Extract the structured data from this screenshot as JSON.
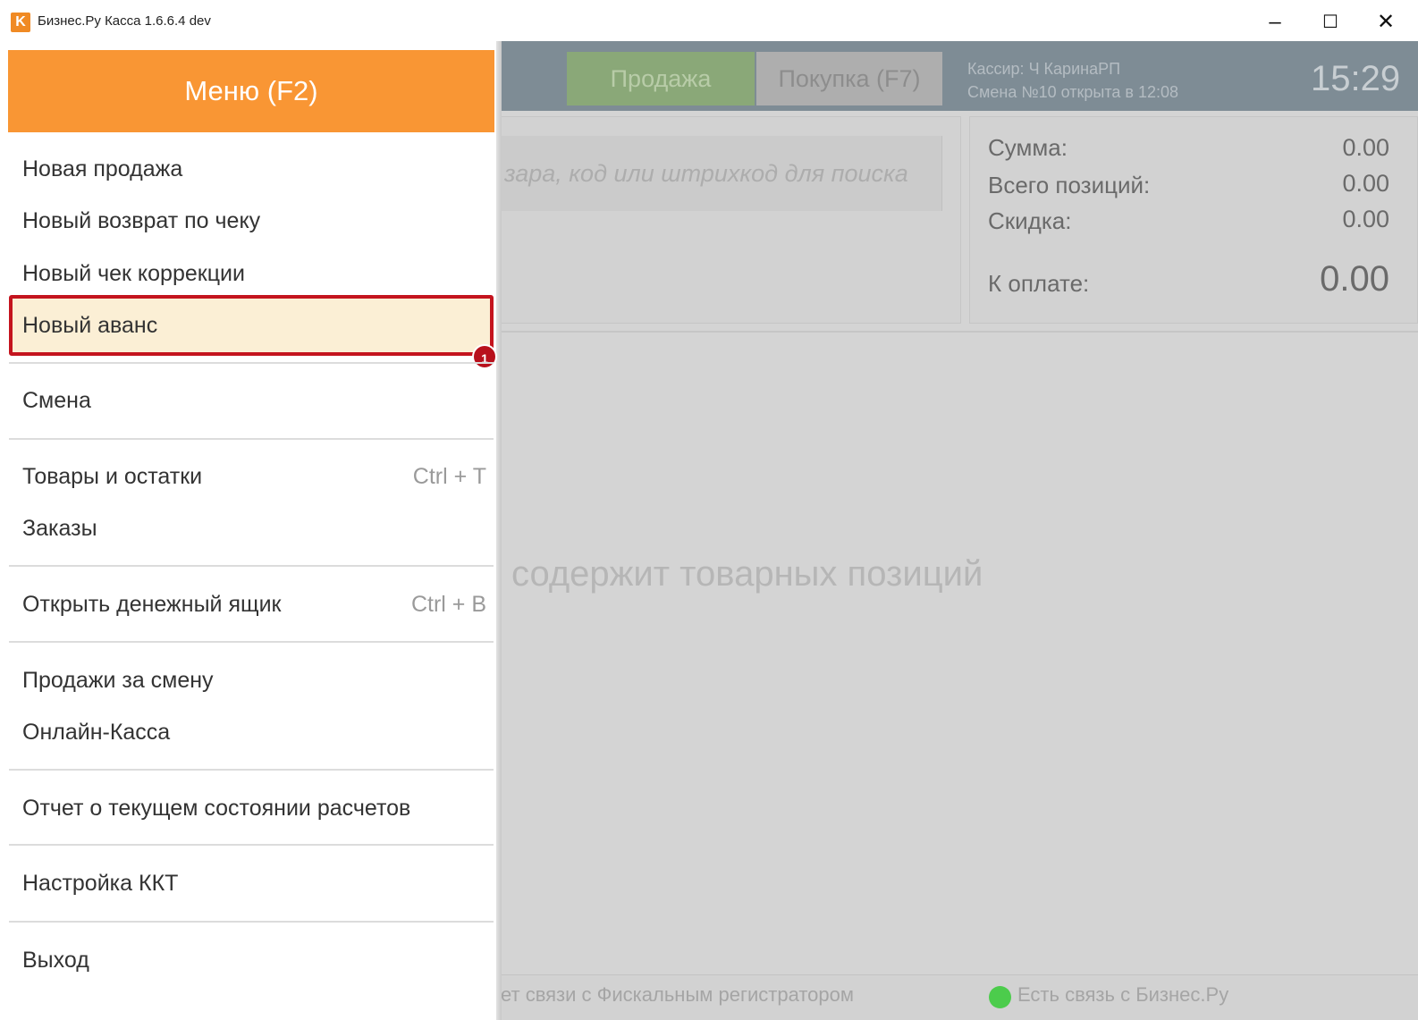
{
  "window": {
    "logo_letter": "K",
    "title": "Бизнес.Ру Касса 1.6.6.4 dev",
    "minimize": "–",
    "maximize": "☐",
    "close": "✕"
  },
  "header": {
    "tab_sale": "Продажа",
    "tab_purchase": "Покупка (F7)",
    "cashier_line": "Кассир: Ч КаринаРП",
    "shift_line": "Смена №10 открыта в 12:08",
    "clock": "15:29"
  },
  "search": {
    "placeholder": "зара, код или штрихкод для поиска"
  },
  "totals": {
    "sum_label": "Сумма:",
    "sum_value": "0.00",
    "positions_label": "Всего позиций:",
    "positions_value": "0.00",
    "discount_label": "Скидка:",
    "discount_value": "0.00",
    "topay_label": "К оплате:",
    "topay_value": "0.00"
  },
  "receipt": {
    "empty_message": "содержит товарных позиций"
  },
  "status": {
    "fiscal_text": "ет связи с Фискальным регистратором",
    "bizru_text": "Есть связь с Бизнес.Ру",
    "bizru_color": "#4ccc4c"
  },
  "menu": {
    "title": "Меню (F2)",
    "items": [
      {
        "label": "Новая продажа"
      },
      {
        "label": "Новый возврат по чеку"
      },
      {
        "label": "Новый чек коррекции"
      },
      {
        "label": "Новый аванс",
        "highlighted": true,
        "badge": "1"
      },
      {
        "label": "Смена"
      },
      {
        "label": "Товары и остатки",
        "shortcut": "Ctrl + T"
      },
      {
        "label": "Заказы"
      },
      {
        "label": "Открыть денежный ящик",
        "shortcut": "Ctrl + B"
      },
      {
        "label": "Продажи за смену"
      },
      {
        "label": "Онлайн-Касса"
      },
      {
        "label": "Отчет о текущем состоянии расчетов"
      },
      {
        "label": "Настройка ККТ"
      },
      {
        "label": "Выход"
      }
    ],
    "accent_color": "#f99634",
    "highlight_border_color": "#c4141e"
  }
}
